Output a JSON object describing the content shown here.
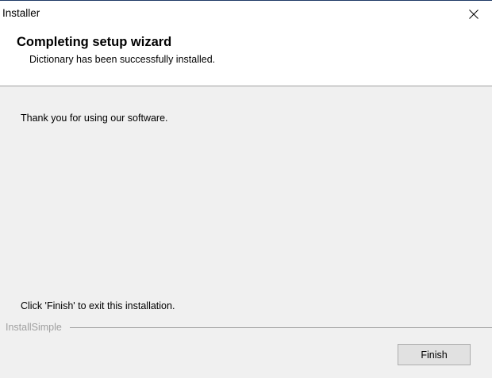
{
  "window": {
    "title": "Installer",
    "close_icon": "close-icon"
  },
  "header": {
    "title": "Completing setup wizard",
    "subtitle": "Dictionary has been successfully installed."
  },
  "body": {
    "message_top": "Thank you for using our software.",
    "message_bottom": "Click 'Finish' to exit this installation."
  },
  "footer": {
    "brand": "InstallSimple",
    "finish_label": "Finish"
  }
}
